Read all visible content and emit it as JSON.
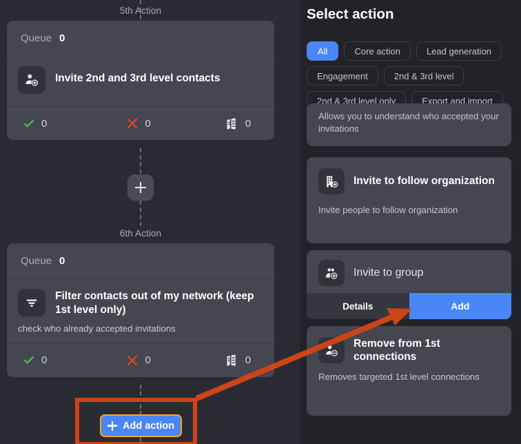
{
  "canvas": {
    "steps": [
      {
        "label": "5th Action",
        "queue_label": "Queue",
        "queue_count": "0",
        "icon": "person-add-icon",
        "title": "Invite 2nd and 3rd level contacts",
        "subtitle": "",
        "stats": [
          {
            "icon": "check-icon",
            "value": "0"
          },
          {
            "icon": "cross-icon",
            "value": "0"
          },
          {
            "icon": "queued-cards-icon",
            "value": "0"
          }
        ]
      },
      {
        "label": "6th Action",
        "queue_label": "Queue",
        "queue_count": "0",
        "icon": "filter-icon",
        "title": "Filter contacts out of my network (keep 1st level only)",
        "subtitle": "check who already accepted invitations",
        "stats": [
          {
            "icon": "check-icon",
            "value": "0"
          },
          {
            "icon": "cross-icon",
            "value": "0"
          },
          {
            "icon": "queued-cards-icon",
            "value": "0"
          }
        ]
      }
    ],
    "add_node_icon": "plus-icon",
    "add_action_label": "Add action",
    "add_action_icon": "plus-icon"
  },
  "panel": {
    "title": "Select action",
    "chips": [
      {
        "label": "All",
        "active": true
      },
      {
        "label": "Core action",
        "active": false
      },
      {
        "label": "Lead generation",
        "active": false
      },
      {
        "label": "Engagement",
        "active": false
      },
      {
        "label": "2nd & 3rd level",
        "active": false
      },
      {
        "label": "2nd & 3rd level only",
        "active": false
      },
      {
        "label": "Export and import",
        "active": false
      }
    ],
    "cards": [
      {
        "icon": "",
        "title": "",
        "desc": "Allows you to understand who accepted your invitations",
        "buttons": []
      },
      {
        "icon": "building-add-icon",
        "title": "Invite to follow organization",
        "desc": "Invite people to follow organization",
        "buttons": []
      },
      {
        "icon": "group-add-icon",
        "title": "Invite to group",
        "desc": "",
        "buttons": [
          {
            "label": "Details",
            "kind": "secondary"
          },
          {
            "label": "Add",
            "kind": "primary"
          }
        ]
      },
      {
        "icon": "person-remove-icon",
        "title": "Remove from 1st connections",
        "desc": "Removes targeted 1st level connections",
        "buttons": []
      }
    ]
  },
  "colors": {
    "accent_blue": "#4a86f7",
    "annotation_orange": "#cc4418",
    "highlight_outline": "#f5a623",
    "success_green": "#3fbf55",
    "error_red": "#e8402a",
    "page_bg": "#2a2b32",
    "panel_bg": "#222329",
    "card_bg": "#45464f"
  },
  "annotation": {
    "highlight_target": "add-action-button",
    "arrow_from": "add-action-button",
    "arrow_to": "invite-to-group-add-button"
  }
}
